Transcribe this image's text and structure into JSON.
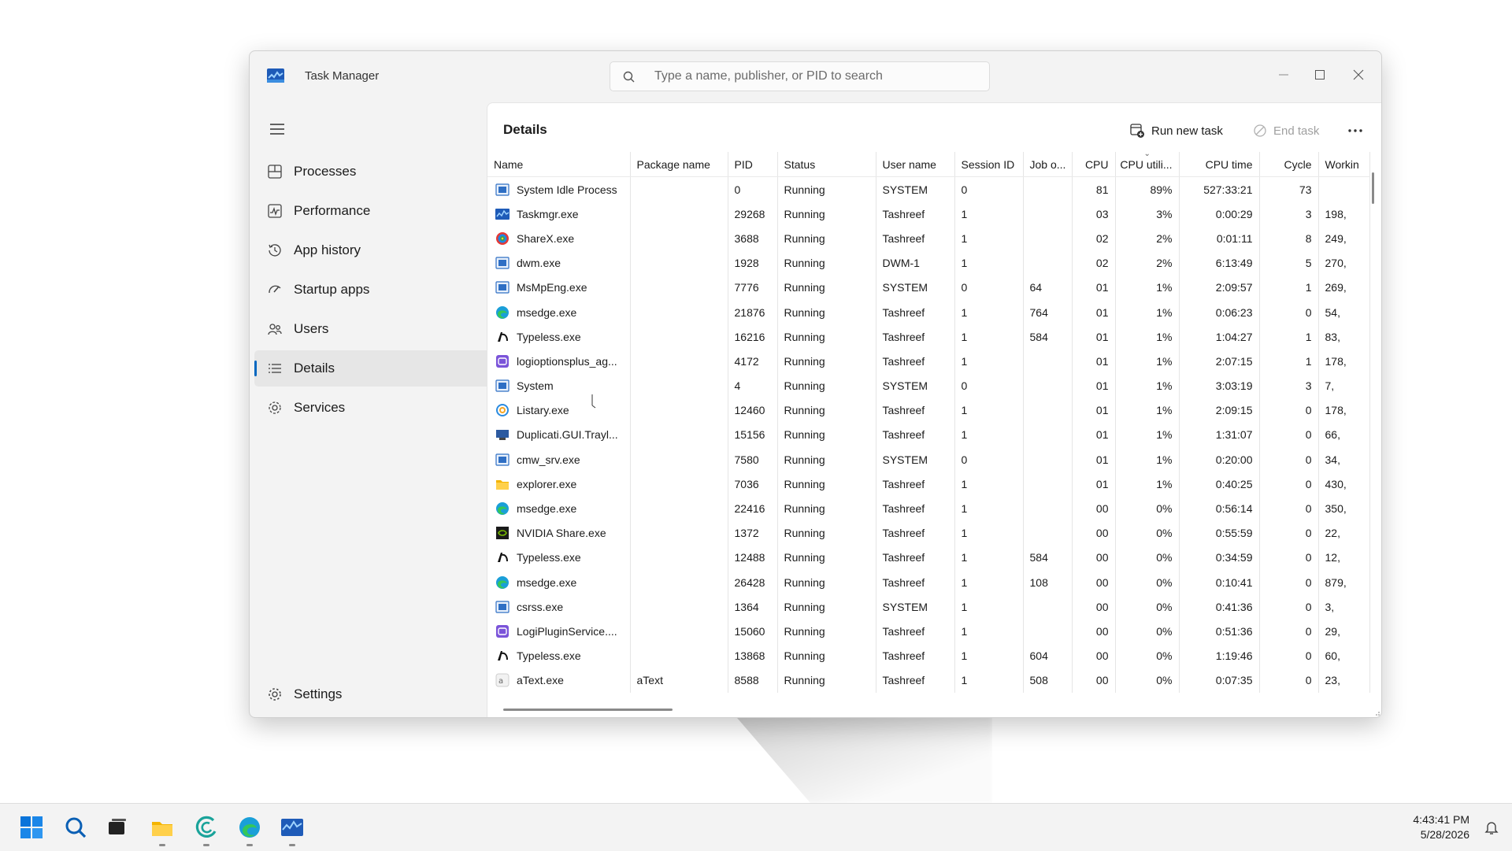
{
  "window": {
    "title": "Task Manager",
    "search_placeholder": "Type a name, publisher, or PID to search"
  },
  "nav": {
    "items": [
      {
        "label": "Processes",
        "icon": "processes-icon"
      },
      {
        "label": "Performance",
        "icon": "performance-icon"
      },
      {
        "label": "App history",
        "icon": "app-history-icon"
      },
      {
        "label": "Startup apps",
        "icon": "startup-apps-icon"
      },
      {
        "label": "Users",
        "icon": "users-icon"
      },
      {
        "label": "Details",
        "icon": "details-icon",
        "active": true
      },
      {
        "label": "Services",
        "icon": "services-icon"
      }
    ],
    "settings": "Settings"
  },
  "details": {
    "title": "Details",
    "run_new_task": "Run new task",
    "end_task": "End task",
    "columns": [
      "Name",
      "Package name",
      "PID",
      "Status",
      "User name",
      "Session ID",
      "Job o...",
      "CPU",
      "CPU utili...",
      "CPU time",
      "Cycle",
      "Workin"
    ],
    "rows": [
      {
        "icon": "system-icon",
        "name": "System Idle Process",
        "pkg": "",
        "pid": "0",
        "status": "Running",
        "user": "SYSTEM",
        "session": "0",
        "job": "",
        "cpu": "81",
        "util": "89%",
        "time": "527:33:21",
        "cycle": "73",
        "working": ""
      },
      {
        "icon": "taskmgr-icon",
        "name": "Taskmgr.exe",
        "pkg": "",
        "pid": "29268",
        "status": "Running",
        "user": "Tashreef",
        "session": "1",
        "job": "",
        "cpu": "03",
        "util": "3%",
        "time": "0:00:29",
        "cycle": "3",
        "working": "198,"
      },
      {
        "icon": "sharex-icon",
        "name": "ShareX.exe",
        "pkg": "",
        "pid": "3688",
        "status": "Running",
        "user": "Tashreef",
        "session": "1",
        "job": "",
        "cpu": "02",
        "util": "2%",
        "time": "0:01:11",
        "cycle": "8",
        "working": "249,"
      },
      {
        "icon": "system-icon",
        "name": "dwm.exe",
        "pkg": "",
        "pid": "1928",
        "status": "Running",
        "user": "DWM-1",
        "session": "1",
        "job": "",
        "cpu": "02",
        "util": "2%",
        "time": "6:13:49",
        "cycle": "5",
        "working": "270,"
      },
      {
        "icon": "system-icon",
        "name": "MsMpEng.exe",
        "pkg": "",
        "pid": "7776",
        "status": "Running",
        "user": "SYSTEM",
        "session": "0",
        "job": "64",
        "cpu": "01",
        "util": "1%",
        "time": "2:09:57",
        "cycle": "1",
        "working": "269,"
      },
      {
        "icon": "edge-icon",
        "name": "msedge.exe",
        "pkg": "",
        "pid": "21876",
        "status": "Running",
        "user": "Tashreef",
        "session": "1",
        "job": "764",
        "cpu": "01",
        "util": "1%",
        "time": "0:06:23",
        "cycle": "0",
        "working": "54,"
      },
      {
        "icon": "typeless-icon",
        "name": "Typeless.exe",
        "pkg": "",
        "pid": "16216",
        "status": "Running",
        "user": "Tashreef",
        "session": "1",
        "job": "584",
        "cpu": "01",
        "util": "1%",
        "time": "1:04:27",
        "cycle": "1",
        "working": "83,"
      },
      {
        "icon": "logi-icon",
        "name": "logioptionsplus_ag...",
        "pkg": "",
        "pid": "4172",
        "status": "Running",
        "user": "Tashreef",
        "session": "1",
        "job": "",
        "cpu": "01",
        "util": "1%",
        "time": "2:07:15",
        "cycle": "1",
        "working": "178,"
      },
      {
        "icon": "system-icon",
        "name": "System",
        "pkg": "",
        "pid": "4",
        "status": "Running",
        "user": "SYSTEM",
        "session": "0",
        "job": "",
        "cpu": "01",
        "util": "1%",
        "time": "3:03:19",
        "cycle": "3",
        "working": "7,"
      },
      {
        "icon": "listary-icon",
        "name": "Listary.exe",
        "pkg": "",
        "pid": "12460",
        "status": "Running",
        "user": "Tashreef",
        "session": "1",
        "job": "",
        "cpu": "01",
        "util": "1%",
        "time": "2:09:15",
        "cycle": "0",
        "working": "178,"
      },
      {
        "icon": "duplicati-icon",
        "name": "Duplicati.GUI.Trayl...",
        "pkg": "",
        "pid": "15156",
        "status": "Running",
        "user": "Tashreef",
        "session": "1",
        "job": "",
        "cpu": "01",
        "util": "1%",
        "time": "1:31:07",
        "cycle": "0",
        "working": "66,"
      },
      {
        "icon": "system-icon",
        "name": "cmw_srv.exe",
        "pkg": "",
        "pid": "7580",
        "status": "Running",
        "user": "SYSTEM",
        "session": "0",
        "job": "",
        "cpu": "01",
        "util": "1%",
        "time": "0:20:00",
        "cycle": "0",
        "working": "34,"
      },
      {
        "icon": "explorer-icon",
        "name": "explorer.exe",
        "pkg": "",
        "pid": "7036",
        "status": "Running",
        "user": "Tashreef",
        "session": "1",
        "job": "",
        "cpu": "01",
        "util": "1%",
        "time": "0:40:25",
        "cycle": "0",
        "working": "430,"
      },
      {
        "icon": "edge-icon",
        "name": "msedge.exe",
        "pkg": "",
        "pid": "22416",
        "status": "Running",
        "user": "Tashreef",
        "session": "1",
        "job": "",
        "cpu": "00",
        "util": "0%",
        "time": "0:56:14",
        "cycle": "0",
        "working": "350,"
      },
      {
        "icon": "nvidia-icon",
        "name": "NVIDIA Share.exe",
        "pkg": "",
        "pid": "1372",
        "status": "Running",
        "user": "Tashreef",
        "session": "1",
        "job": "",
        "cpu": "00",
        "util": "0%",
        "time": "0:55:59",
        "cycle": "0",
        "working": "22,"
      },
      {
        "icon": "typeless-icon",
        "name": "Typeless.exe",
        "pkg": "",
        "pid": "12488",
        "status": "Running",
        "user": "Tashreef",
        "session": "1",
        "job": "584",
        "cpu": "00",
        "util": "0%",
        "time": "0:34:59",
        "cycle": "0",
        "working": "12,"
      },
      {
        "icon": "edge-icon",
        "name": "msedge.exe",
        "pkg": "",
        "pid": "26428",
        "status": "Running",
        "user": "Tashreef",
        "session": "1",
        "job": "108",
        "cpu": "00",
        "util": "0%",
        "time": "0:10:41",
        "cycle": "0",
        "working": "879,"
      },
      {
        "icon": "system-icon",
        "name": "csrss.exe",
        "pkg": "",
        "pid": "1364",
        "status": "Running",
        "user": "SYSTEM",
        "session": "1",
        "job": "",
        "cpu": "00",
        "util": "0%",
        "time": "0:41:36",
        "cycle": "0",
        "working": "3,"
      },
      {
        "icon": "logi-icon",
        "name": "LogiPluginService....",
        "pkg": "",
        "pid": "15060",
        "status": "Running",
        "user": "Tashreef",
        "session": "1",
        "job": "",
        "cpu": "00",
        "util": "0%",
        "time": "0:51:36",
        "cycle": "0",
        "working": "29,"
      },
      {
        "icon": "typeless-icon",
        "name": "Typeless.exe",
        "pkg": "",
        "pid": "13868",
        "status": "Running",
        "user": "Tashreef",
        "session": "1",
        "job": "604",
        "cpu": "00",
        "util": "0%",
        "time": "1:19:46",
        "cycle": "0",
        "working": "60,"
      },
      {
        "icon": "atext-icon",
        "name": "aText.exe",
        "pkg": "aText",
        "pid": "8588",
        "status": "Running",
        "user": "Tashreef",
        "session": "1",
        "job": "508",
        "cpu": "00",
        "util": "0%",
        "time": "0:07:35",
        "cycle": "0",
        "working": "23,"
      }
    ]
  },
  "taskbar": {
    "time": "4:43:41 PM",
    "date": "5/28/2026"
  },
  "colors": {
    "accent": "#0067c0",
    "window_bg": "#f3f3f3",
    "content_bg": "#ffffff"
  }
}
